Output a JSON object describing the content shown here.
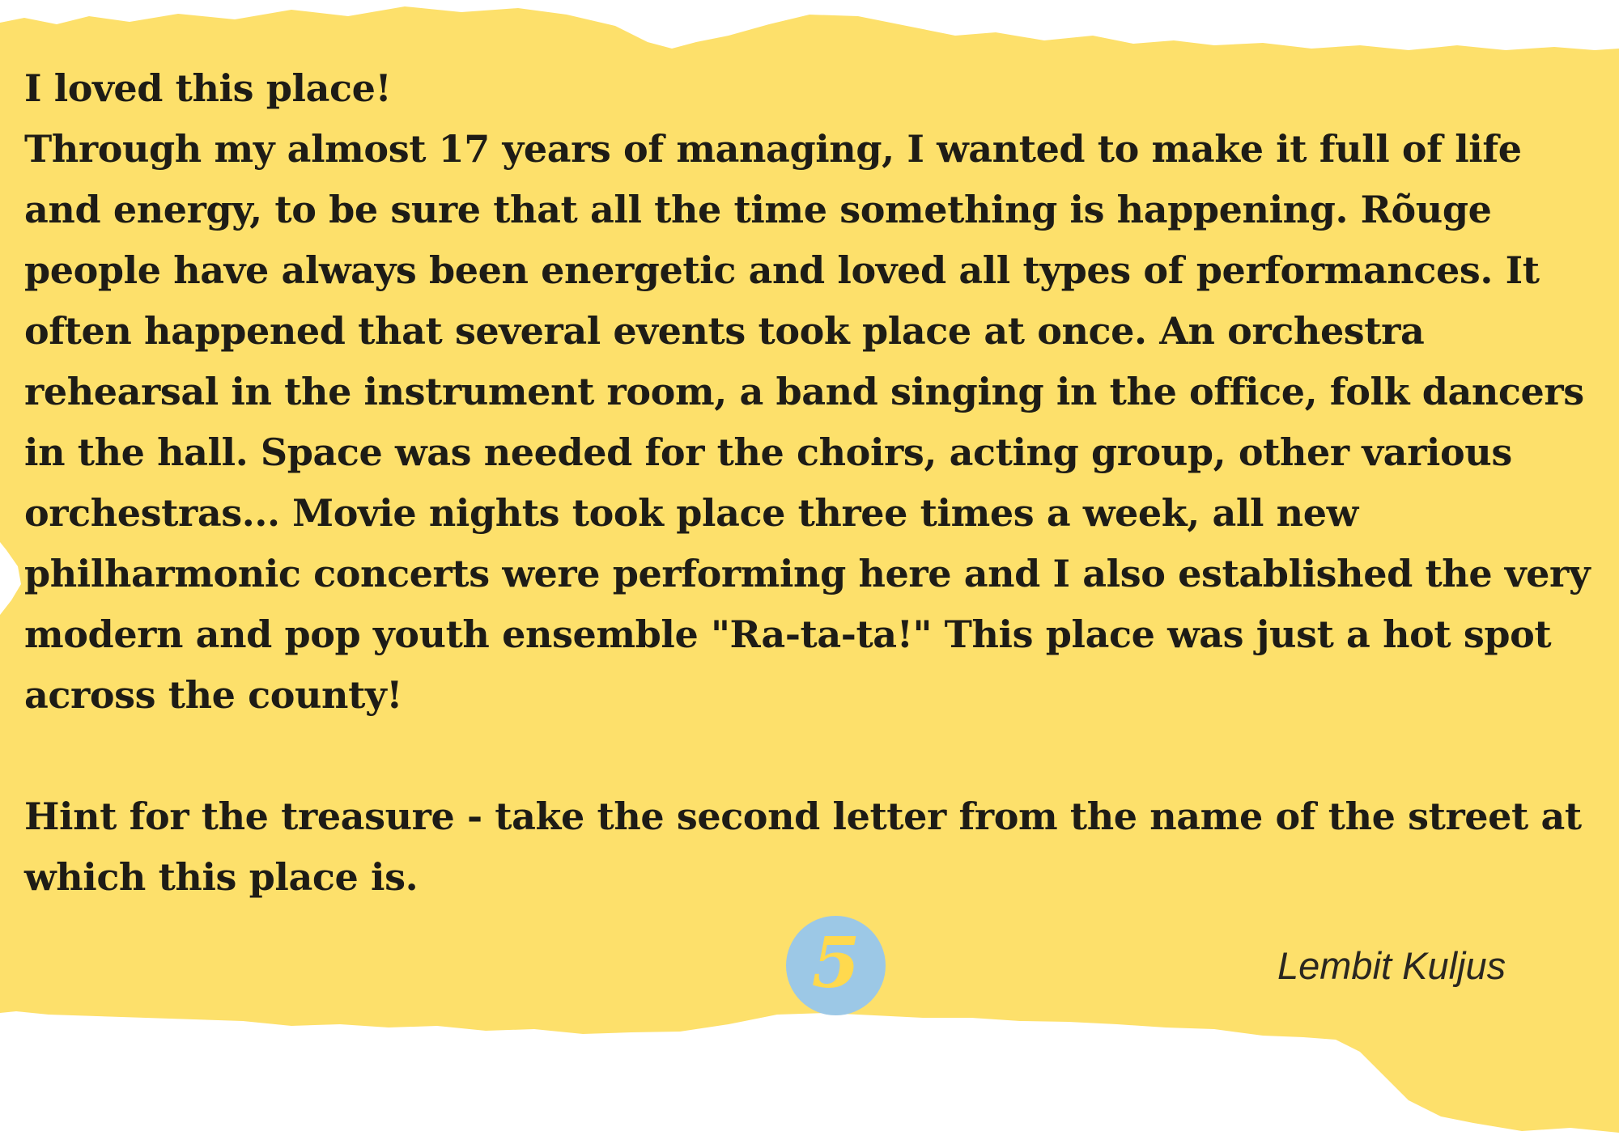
{
  "colors": {
    "paper": "#fde06b",
    "background": "#ffffff",
    "badge": "#9cc8e6",
    "badge_text": "#ffd94e",
    "text": "#1e1c16"
  },
  "note": {
    "opening": "I loved this place!",
    "paragraph": "Through my almost 17 years of managing, I wanted to make it full of life and energy, to be sure that all the time something is happening. Rõuge people have always been energetic and loved all types of performances. It often happened that several events took place at once. An orchestra rehearsal in the instrument room, a band singing in the office, folk dancers in the hall. Space was needed for the choirs, acting group, other various orchestras... Movie nights took place three times a week, all new philharmonic concerts were performing here and I also established the very modern and pop youth ensemble \"Ra-ta-ta!\" This place was just a hot spot across the county!",
    "hint": "Hint for the treasure - take the second letter from the name of the street at which this place is."
  },
  "badge": {
    "number": "5"
  },
  "signature": {
    "name": "Lembit Kuljus"
  }
}
